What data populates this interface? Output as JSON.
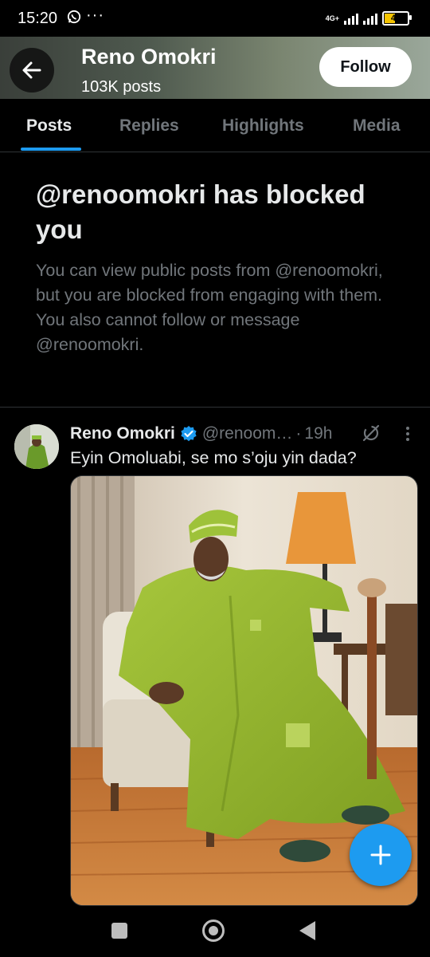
{
  "status_bar": {
    "time": "15:20",
    "network": "4G+",
    "battery": "43",
    "battery_level": 0.43
  },
  "header": {
    "title": "Reno Omokri",
    "subtitle": "103K posts",
    "follow_label": "Follow"
  },
  "tabs": [
    {
      "label": "Posts",
      "active": true
    },
    {
      "label": "Replies",
      "active": false
    },
    {
      "label": "Highlights",
      "active": false
    },
    {
      "label": "Media",
      "active": false
    }
  ],
  "blocked": {
    "title": "@renoomokri has blocked you",
    "description": "You can view public posts from @renoomokri, but you are blocked from engaging with them. You also cannot follow or message @renoomokri."
  },
  "tweet": {
    "name": "Reno Omokri",
    "handle": "@renoom…",
    "separator": "·",
    "time": "19h",
    "text": "Eyin Omoluabi, se mo s’oju yin dada?"
  },
  "colors": {
    "accent": "#1d9bf0",
    "background": "#000000",
    "muted": "#71767b",
    "text": "#e7e9ea"
  },
  "icons": [
    "back-arrow-icon",
    "verified-badge-icon",
    "grok-icon",
    "more-icon",
    "plus-icon",
    "whatsapp-icon"
  ]
}
